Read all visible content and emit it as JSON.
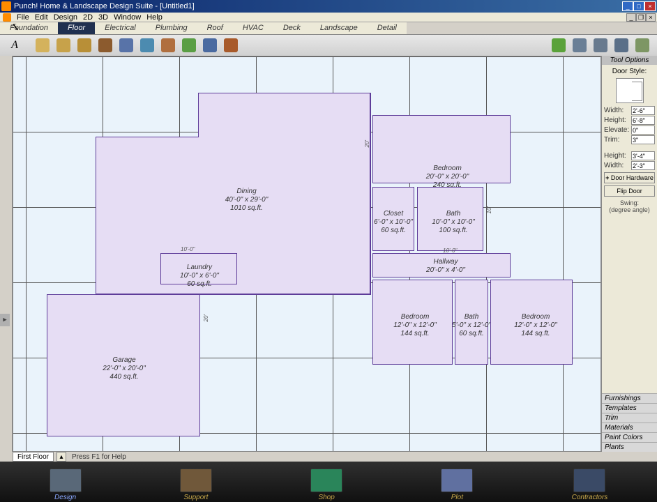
{
  "app": {
    "title": "Punch! Home & Landscape Design Suite - [Untitled1]"
  },
  "menu": {
    "file": "File",
    "edit": "Edit",
    "design": "Design",
    "d2": "2D",
    "d3": "3D",
    "window": "Window",
    "help": "Help"
  },
  "tabs": {
    "items": [
      "Foundation",
      "Floor",
      "Electrical",
      "Plumbing",
      "Roof",
      "HVAC",
      "Deck",
      "Landscape",
      "Detail"
    ],
    "active": 1
  },
  "toolbar": {
    "left": [
      {
        "name": "pointer-tool",
        "glyph": "↖"
      },
      {
        "name": "text-tool",
        "glyph": "A"
      },
      {
        "name": "dimension-tool",
        "glyph": "⟷"
      }
    ],
    "mid": [
      {
        "name": "folder-1-icon",
        "color": "#d4b25c"
      },
      {
        "name": "folder-2-icon",
        "color": "#c7a24a"
      },
      {
        "name": "folder-3-icon",
        "color": "#b88f37"
      },
      {
        "name": "door-tool-icon",
        "color": "#8c5b2e"
      },
      {
        "name": "window-tool-icon",
        "color": "#5873a8"
      },
      {
        "name": "sink-tool-icon",
        "color": "#4c8bb0"
      },
      {
        "name": "tub-tool-icon",
        "color": "#b06f3f"
      },
      {
        "name": "plant-tool-icon",
        "color": "#5a9e44"
      },
      {
        "name": "column-tool-icon",
        "color": "#4a6aa0"
      },
      {
        "name": "brick-tool-icon",
        "color": "#a85a2a"
      }
    ],
    "right": [
      {
        "name": "eco-icon",
        "color": "#5aa23a"
      },
      {
        "name": "view-1-icon",
        "color": "#6a7f96"
      },
      {
        "name": "view-2-icon",
        "color": "#687a8e"
      },
      {
        "name": "view-3-icon",
        "color": "#5a6f88"
      },
      {
        "name": "view-4-icon",
        "color": "#7d9664"
      }
    ]
  },
  "statusbar": {
    "floor": "First Floor",
    "help": "Press F1 for Help"
  },
  "tool_options": {
    "header": "Tool Options",
    "door_style": "Door Style:",
    "width_label": "Width:",
    "width_value": "2'-6\"",
    "height_label": "Height:",
    "height_value": "6'-8\"",
    "elevate_label": "Elevate:",
    "elevate_value": "0\"",
    "trim_label": "Trim:",
    "trim_value": "3\"",
    "height2_label": "Height:",
    "height2_value": "3'-4\"",
    "width2_label": "Width:",
    "width2_value": "2'-3\"",
    "hardware_btn": "Door Hardware",
    "flip_btn": "Flip Door",
    "swing_label": "Swing:",
    "swing_hint": "(degree angle)",
    "categories": [
      "Furnishings",
      "Templates",
      "Trim",
      "Materials",
      "Paint Colors",
      "Plants"
    ]
  },
  "rooms": {
    "dining": {
      "name": "Dining",
      "dims": "40'-0\" x 29'-0\"",
      "area": "1010 sq.ft."
    },
    "laundry": {
      "name": "Laundry",
      "dims": "10'-0\" x 6'-0\"",
      "area": "60 sq.ft."
    },
    "garage": {
      "name": "Garage",
      "dims": "22'-0\" x 20'-0\"",
      "area": "440 sq.ft."
    },
    "bedroom1": {
      "name": "Bedroom",
      "dims": "20'-0\" x 20'-0\"",
      "area": "240 sq.ft."
    },
    "closet": {
      "name": "Closet",
      "dims": "6'-0\" x 10'-0\"",
      "area": "60 sq.ft."
    },
    "bath1": {
      "name": "Bath",
      "dims": "10'-0\" x 10'-0\"",
      "area": "100 sq.ft."
    },
    "hallway": {
      "name": "Hallway",
      "dims": "20'-0\" x 4'-0\""
    },
    "bedroom2": {
      "name": "Bedroom",
      "dims": "12'-0\" x 12'-0\"",
      "area": "144 sq.ft."
    },
    "bath2": {
      "name": "Bath",
      "dims": "5'-0\" x 12'-0\"",
      "area": "60 sq.ft."
    },
    "bedroom3": {
      "name": "Bedroom",
      "dims": "12'-0\" x 12'-0\"",
      "area": "144 sq.ft."
    }
  },
  "bottom": {
    "items": [
      {
        "name": "design",
        "label": "Design"
      },
      {
        "name": "support",
        "label": "Support"
      },
      {
        "name": "shop",
        "label": "Shop"
      },
      {
        "name": "plot",
        "label": "Plot"
      },
      {
        "name": "contractors",
        "label": "Contractors"
      }
    ]
  }
}
